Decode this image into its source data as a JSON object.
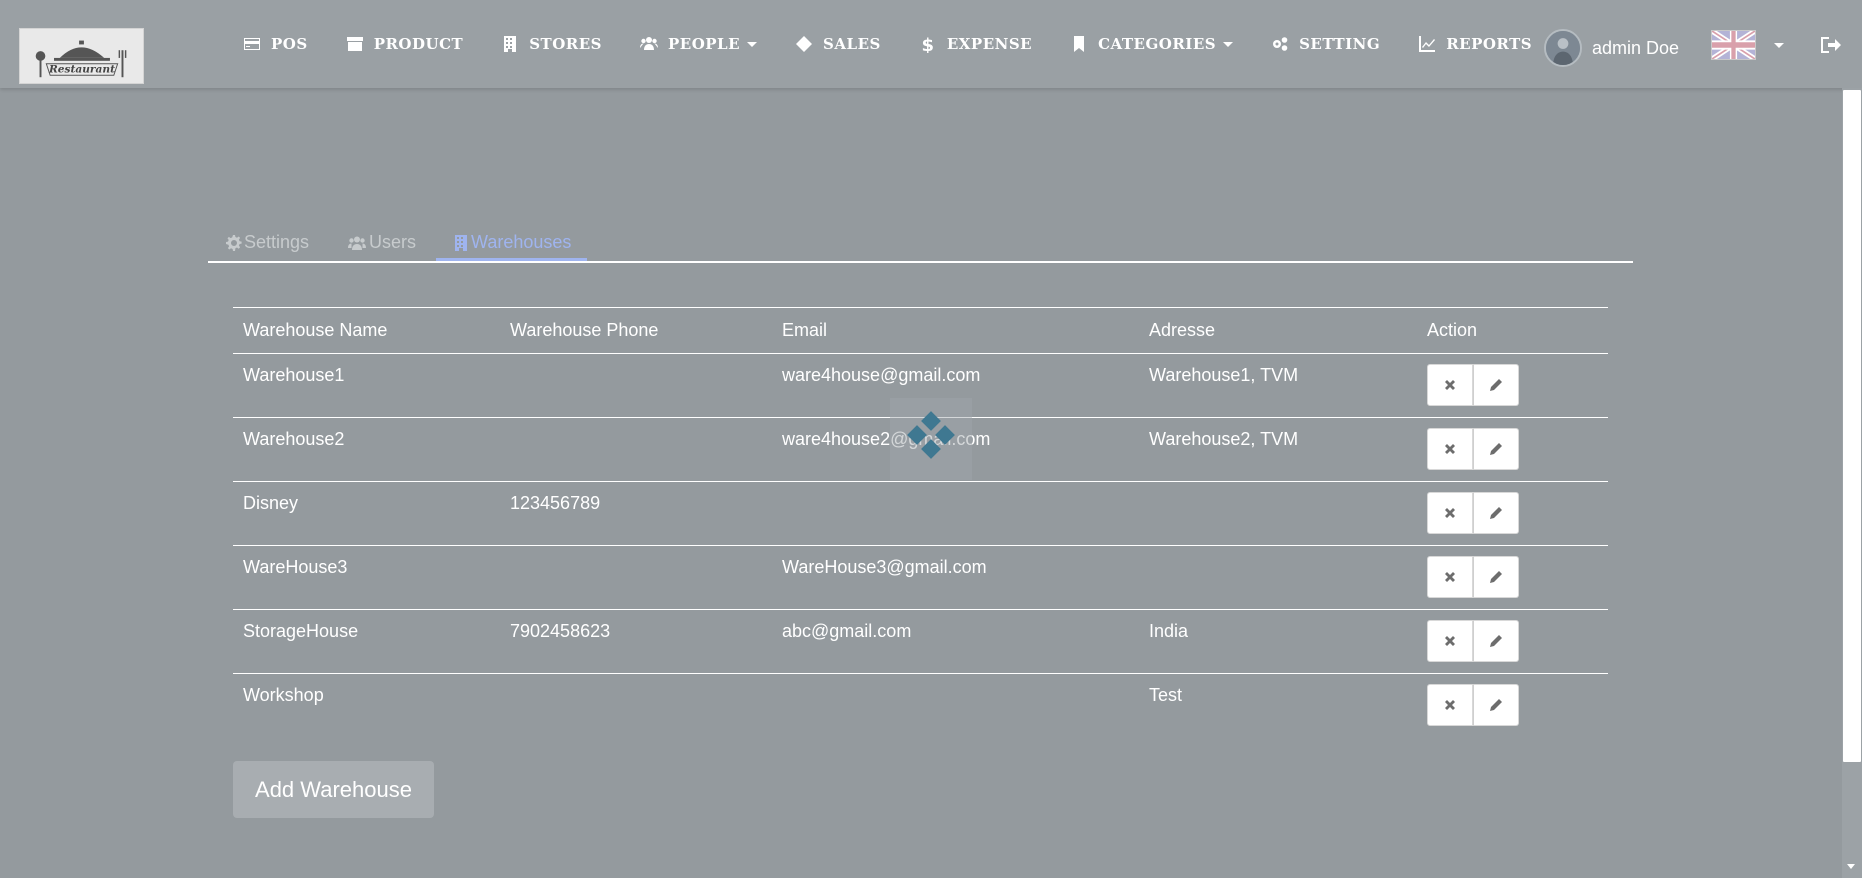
{
  "logo": {
    "text": "Restaurant"
  },
  "nav": [
    {
      "label": "POS",
      "icon": "credit-card-icon"
    },
    {
      "label": "PRODUCT",
      "icon": "archive-icon"
    },
    {
      "label": "STORES",
      "icon": "building-icon"
    },
    {
      "label": "PEOPLE",
      "icon": "users-icon",
      "dropdown": true
    },
    {
      "label": "SALES",
      "icon": "ticket-icon"
    },
    {
      "label": "EXPENSE",
      "icon": "dollar-icon"
    },
    {
      "label": "CATEGORIES",
      "icon": "bookmark-icon",
      "dropdown": true
    },
    {
      "label": "SETTING",
      "icon": "cogs-icon"
    },
    {
      "label": "REPORTS",
      "icon": "line-chart-icon"
    }
  ],
  "user": {
    "name": "admin Doe"
  },
  "tabs": [
    {
      "label": "Settings",
      "icon": "cog-icon",
      "active": false
    },
    {
      "label": "Users",
      "icon": "users-icon",
      "active": false
    },
    {
      "label": "Warehouses",
      "icon": "building-icon",
      "active": true
    }
  ],
  "table": {
    "headers": [
      "Warehouse Name",
      "Warehouse Phone",
      "Email",
      "Adresse",
      "Action"
    ],
    "rows": [
      {
        "name": "Warehouse1",
        "phone": "",
        "email": "ware4house@gmail.com",
        "address": "Warehouse1, TVM"
      },
      {
        "name": "Warehouse2",
        "phone": "",
        "email": "ware4house2@gmail.com",
        "address": "Warehouse2, TVM"
      },
      {
        "name": "Disney",
        "phone": "123456789",
        "email": "",
        "address": ""
      },
      {
        "name": "WareHouse3",
        "phone": "",
        "email": "WareHouse3@gmail.com",
        "address": ""
      },
      {
        "name": "StorageHouse",
        "phone": "7902458623",
        "email": "abc@gmail.com",
        "address": "India"
      },
      {
        "name": "Workshop",
        "phone": "",
        "email": "",
        "address": "Test"
      }
    ]
  },
  "add_button": "Add Warehouse",
  "colors": {
    "overlay": "#949a9e",
    "active_tab": "#9fb4ef",
    "loader": "#3f7891"
  }
}
